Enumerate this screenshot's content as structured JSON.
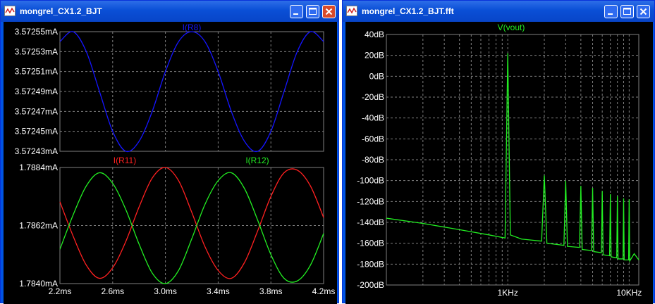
{
  "left_window": {
    "title": "mongrel_CX1.2_BJT",
    "buttons": {
      "minimize": "minimize-icon",
      "maximize": "maximize-icon",
      "close": "close-icon"
    }
  },
  "right_window": {
    "title": "mongrel_CX1.2_BJT.fft",
    "buttons": {
      "minimize": "minimize-icon",
      "maximize": "maximize-icon",
      "close": "close-icon"
    }
  },
  "colors": {
    "red": "#ff2020",
    "green": "#22ee22",
    "blue": "#1515ff",
    "grid": "#7f7f7f",
    "axis_text": "#ffffff"
  },
  "chart_data": [
    {
      "type": "line",
      "title": "",
      "xlabel": "",
      "ylabel": "",
      "xlim": [
        2.2,
        4.2
      ],
      "ylim": [
        3.57243,
        3.57255
      ],
      "grid": true,
      "series": [
        {
          "name": "I(R8)",
          "color": "#1515ff",
          "x": [
            2.2,
            2.3,
            2.4,
            2.5,
            2.6,
            2.7,
            2.8,
            2.9,
            3.0,
            3.1,
            3.2,
            3.3,
            3.4,
            3.5,
            3.6,
            3.7,
            3.8,
            3.9,
            4.0,
            4.1,
            4.2
          ],
          "y": [
            3.57254,
            3.57255,
            3.57253,
            3.57249,
            3.57245,
            3.57243,
            3.57244,
            3.57247,
            3.57251,
            3.57254,
            3.57255,
            3.57254,
            3.57251,
            3.57247,
            3.57244,
            3.57243,
            3.57245,
            3.57249,
            3.57253,
            3.57255,
            3.57254
          ]
        }
      ],
      "x_ticks": [
        "2.2ms",
        "2.6ms",
        "3.0ms",
        "3.4ms",
        "3.8ms",
        "4.2ms"
      ],
      "y_ticks": [
        "3.57255mA",
        "3.57253mA",
        "3.57251mA",
        "3.57249mA",
        "3.57247mA",
        "3.57245mA",
        "3.57243mA"
      ]
    },
    {
      "type": "line",
      "title": "",
      "xlabel": "",
      "ylabel": "",
      "xlim": [
        2.2,
        4.2
      ],
      "ylim": [
        1.784,
        1.7884
      ],
      "grid": true,
      "series": [
        {
          "name": "I(R11)",
          "color": "#ff2020",
          "x": [
            2.2,
            2.3,
            2.4,
            2.5,
            2.6,
            2.7,
            2.8,
            2.9,
            3.0,
            3.1,
            3.2,
            3.3,
            3.4,
            3.5,
            3.6,
            3.7,
            3.8,
            3.9,
            4.0,
            4.1,
            4.2
          ],
          "y": [
            1.7871,
            1.7858,
            1.7847,
            1.7842,
            1.7846,
            1.7856,
            1.7869,
            1.788,
            1.7884,
            1.7879,
            1.7867,
            1.7854,
            1.7845,
            1.7842,
            1.7848,
            1.786,
            1.7873,
            1.7882,
            1.7883,
            1.7877,
            1.7865
          ]
        },
        {
          "name": "I(R12)",
          "color": "#22ee22",
          "x": [
            2.2,
            2.3,
            2.4,
            2.5,
            2.6,
            2.7,
            2.8,
            2.9,
            3.0,
            3.1,
            3.2,
            3.3,
            3.4,
            3.5,
            3.6,
            3.7,
            3.8,
            3.9,
            4.0,
            4.1,
            4.2
          ],
          "y": [
            1.7853,
            1.7866,
            1.7877,
            1.7882,
            1.7878,
            1.7868,
            1.7855,
            1.7844,
            1.784,
            1.7845,
            1.7857,
            1.787,
            1.7879,
            1.7882,
            1.7876,
            1.7864,
            1.7851,
            1.7842,
            1.7841,
            1.7847,
            1.7859
          ]
        }
      ],
      "x_ticks": [
        "2.2ms",
        "2.6ms",
        "3.0ms",
        "3.4ms",
        "3.8ms",
        "4.2ms"
      ],
      "y_ticks": [
        "1.7884mA",
        "1.7862mA",
        "1.7840mA"
      ]
    },
    {
      "type": "line",
      "title": "",
      "xlabel": "",
      "ylabel": "",
      "x_scale": "log",
      "xlim": [
        100,
        12000
      ],
      "ylim": [
        -200,
        40
      ],
      "grid": true,
      "series": [
        {
          "name": "V(vout)",
          "color": "#22ee22",
          "x": [
            100,
            200,
            400,
            700,
            950,
            1000,
            1050,
            1300,
            1900,
            2000,
            2100,
            2900,
            3000,
            3100,
            3900,
            4000,
            4100,
            4900,
            5000,
            5100,
            5900,
            6000,
            6100,
            6900,
            7000,
            7100,
            7900,
            8000,
            8100,
            8900,
            9000,
            9100,
            9900,
            10000,
            10100,
            11000,
            12000
          ],
          "y": [
            -136,
            -141,
            -147,
            -152,
            -155,
            22,
            -152,
            -156,
            -158,
            -95,
            -160,
            -162,
            -100,
            -163,
            -164,
            -105,
            -166,
            -167,
            -107,
            -168,
            -169,
            -110,
            -171,
            -172,
            -113,
            -173,
            -174,
            -115,
            -175,
            -175,
            -117,
            -176,
            -176,
            -118,
            -177,
            -170,
            -176
          ]
        }
      ],
      "x_ticks": [
        "1KHz",
        "10KHz"
      ],
      "y_ticks": [
        "40dB",
        "20dB",
        "0dB",
        "-20dB",
        "-40dB",
        "-60dB",
        "-80dB",
        "-100dB",
        "-120dB",
        "-140dB",
        "-160dB",
        "-180dB",
        "-200dB"
      ]
    }
  ]
}
